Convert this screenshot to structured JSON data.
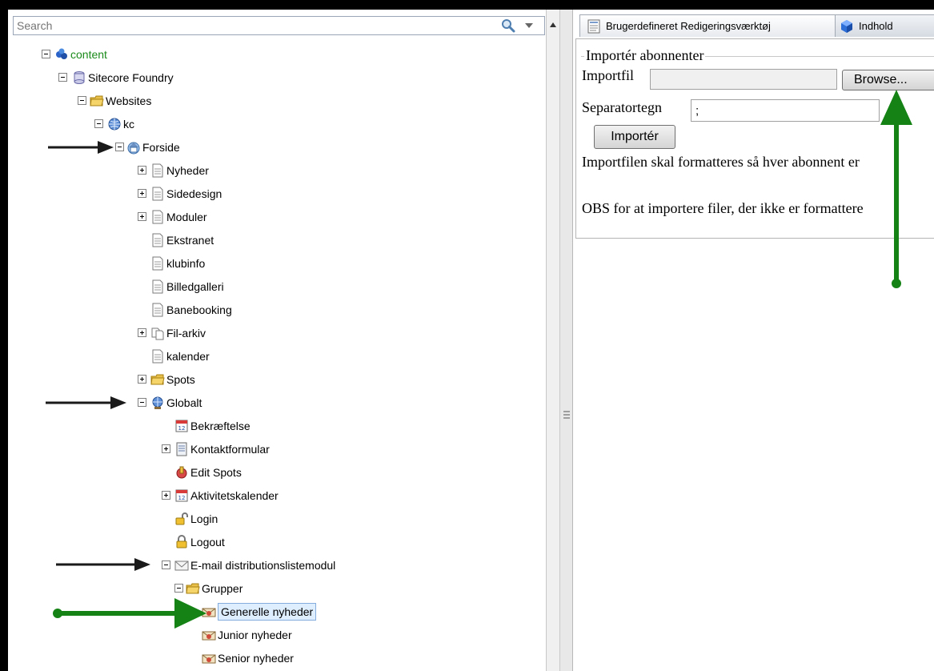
{
  "search": {
    "placeholder": "Search"
  },
  "tree": [
    {
      "label": "content",
      "level": 0,
      "toggle": "minus",
      "icon": "content-icon",
      "color": "#1a8a1a"
    },
    {
      "label": "Sitecore Foundry",
      "level": 1,
      "toggle": "minus",
      "icon": "database-icon"
    },
    {
      "label": "Websites",
      "level": 2,
      "toggle": "minus",
      "icon": "folder-icon"
    },
    {
      "label": "kc",
      "level": 3,
      "toggle": "minus",
      "icon": "globe-icon"
    },
    {
      "label": "Forside",
      "level": 4,
      "toggle": "minus",
      "icon": "home-icon"
    },
    {
      "label": "Nyheder",
      "level": 5,
      "toggle": "plus",
      "icon": "document-icon"
    },
    {
      "label": "Sidedesign",
      "level": 5,
      "toggle": "plus",
      "icon": "document-icon"
    },
    {
      "label": "Moduler",
      "level": 5,
      "toggle": "plus",
      "icon": "document-icon"
    },
    {
      "label": "Ekstranet",
      "level": 5,
      "toggle": "none",
      "icon": "document-icon"
    },
    {
      "label": "klubinfo",
      "level": 5,
      "toggle": "none",
      "icon": "document-icon"
    },
    {
      "label": "Billedgalleri",
      "level": 5,
      "toggle": "none",
      "icon": "document-icon"
    },
    {
      "label": "Banebooking",
      "level": 5,
      "toggle": "none",
      "icon": "document-icon"
    },
    {
      "label": "Fil-arkiv",
      "level": 5,
      "toggle": "plus",
      "icon": "documents-icon"
    },
    {
      "label": "kalender",
      "level": 5,
      "toggle": "none",
      "icon": "document-icon"
    },
    {
      "label": "Spots",
      "level": 5,
      "toggle": "plus",
      "icon": "folder-icon"
    },
    {
      "label": "Globalt",
      "level": 5,
      "toggle": "minus",
      "icon": "globe-person-icon"
    },
    {
      "label": "Bekræftelse",
      "level": 6,
      "toggle": "none",
      "icon": "calendar-icon"
    },
    {
      "label": "Kontaktformular",
      "level": 6,
      "toggle": "plus",
      "icon": "form-icon"
    },
    {
      "label": "Edit Spots",
      "level": 6,
      "toggle": "none",
      "icon": "spot-edit-icon"
    },
    {
      "label": "Aktivitetskalender",
      "level": 6,
      "toggle": "plus",
      "icon": "calendar-icon"
    },
    {
      "label": "Login",
      "level": 6,
      "toggle": "none",
      "icon": "lock-open-icon"
    },
    {
      "label": "Logout",
      "level": 6,
      "toggle": "none",
      "icon": "lock-icon"
    },
    {
      "label": "E-mail distributionslistemodul",
      "level": 6,
      "toggle": "minus",
      "icon": "envelope-icon"
    },
    {
      "label": "Grupper",
      "level": 7,
      "toggle": "minus",
      "icon": "folder-icon"
    },
    {
      "label": "Generelle nyheder",
      "level": 8,
      "toggle": "none",
      "icon": "mail-group-icon",
      "selected": true
    },
    {
      "label": "Junior nyheder",
      "level": 8,
      "toggle": "none",
      "icon": "mail-group-icon"
    },
    {
      "label": "Senior nyheder",
      "level": 8,
      "toggle": "none",
      "icon": "mail-group-icon"
    }
  ],
  "tabs": {
    "editor": "Brugerdefineret Redigeringsværktøj",
    "content": "Indhold"
  },
  "form": {
    "legend": "Importér abonnenter",
    "file_label": "Importfil",
    "browse_label": "Browse...",
    "separator_label": "Separatortegn",
    "separator_value": ";",
    "import_label": "Importér",
    "info_1": "Importfilen skal formatteres så hver abonnent er",
    "info_2": "OBS for at importere filer, der ikke er formattere"
  },
  "colors": {
    "arrow_black": "#1a1a1a",
    "arrow_green": "#148214",
    "selection": "#dfeeff",
    "content_label": "#1a8a1a"
  }
}
